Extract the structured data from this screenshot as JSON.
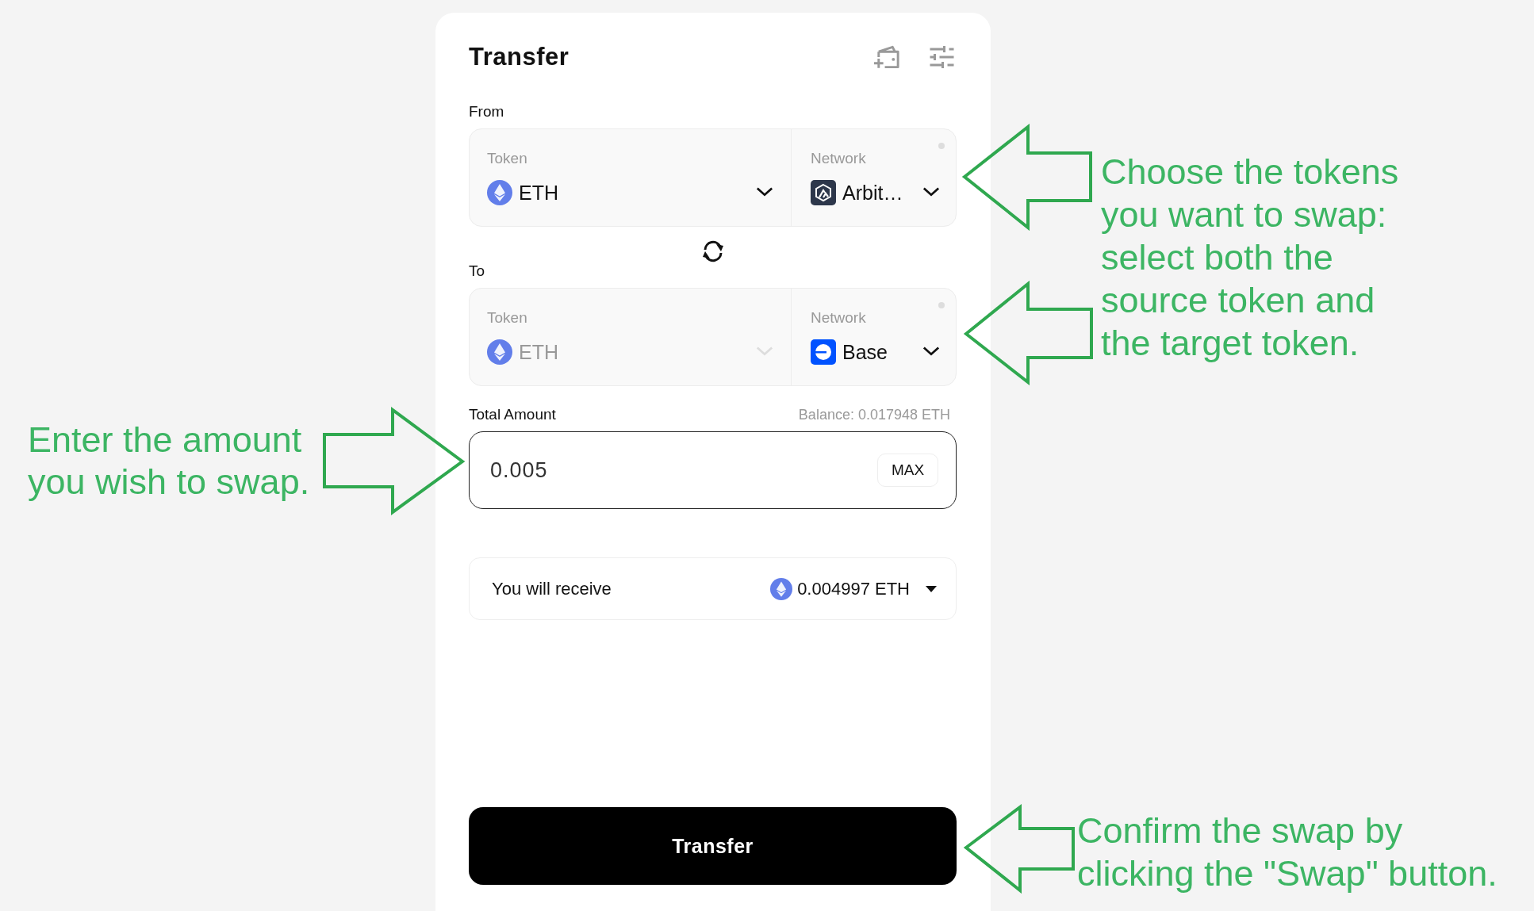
{
  "card": {
    "title": "Transfer"
  },
  "from": {
    "label": "From",
    "token": {
      "label": "Token",
      "value": "ETH",
      "disabled": false
    },
    "network": {
      "label": "Network",
      "value": "Arbit…",
      "kind": "arbitrum"
    }
  },
  "to": {
    "label": "To",
    "token": {
      "label": "Token",
      "value": "ETH",
      "disabled": true
    },
    "network": {
      "label": "Network",
      "value": "Base",
      "kind": "base"
    }
  },
  "amount": {
    "label": "Total Amount",
    "balance": "Balance: 0.017948 ETH",
    "value": "0.005",
    "max_button": "MAX"
  },
  "receive": {
    "label": "You will receive",
    "value": "0.004997 ETH"
  },
  "submit": "Transfer",
  "annotations": [
    {
      "kind": "tokens",
      "text": "Choose the tokens you want to swap: select both the source token and the target token."
    },
    {
      "kind": "amount",
      "text": "Enter the amount you wish to swap."
    },
    {
      "kind": "confirm",
      "text": "Confirm the swap by clicking the \"Swap\" button."
    }
  ]
}
